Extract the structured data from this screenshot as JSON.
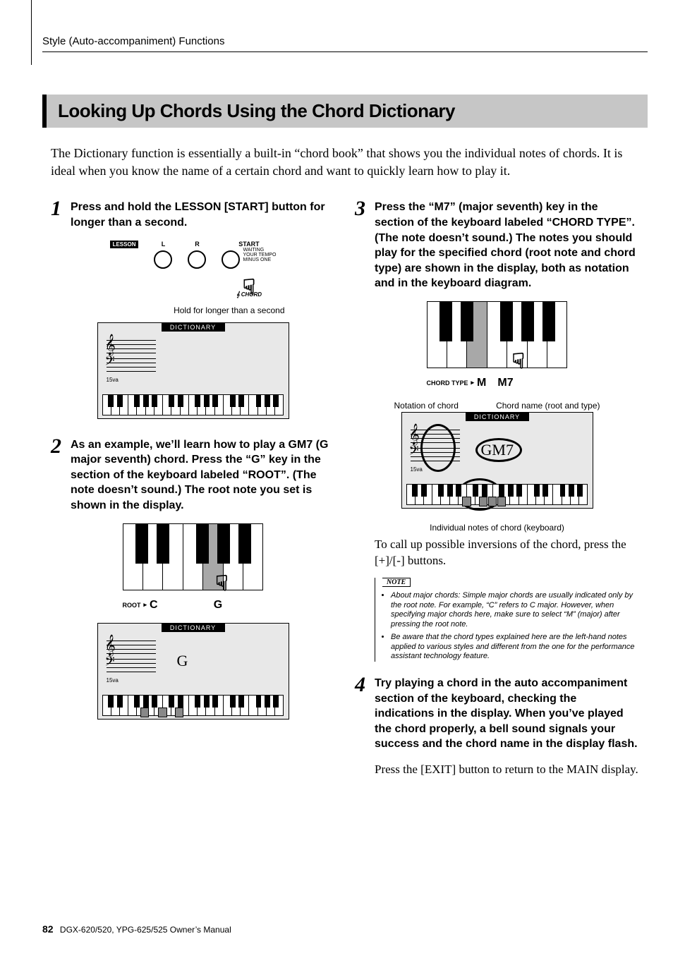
{
  "header": "Style (Auto-accompaniment) Functions",
  "section_title": "Looking Up Chords Using the Chord Dictionary",
  "intro": "The Dictionary function is essentially a built-in “chord book” that shows you the individual notes of chords. It is ideal when you know the name of a certain chord and want to quickly learn how to play it.",
  "step1": {
    "num": "1",
    "text": "Press and hold the LESSON [START] button for longer than a second.",
    "lesson_label": "LESSON",
    "btn_l": "L",
    "btn_r": "R",
    "btn_start": "START",
    "waiting_lines": "WAITING\nYOUR TEMPO\nMINUS ONE",
    "chord_small": "CHORD",
    "hold_caption": "Hold for longer than a second",
    "dict_title": "DICTIONARY"
  },
  "step2": {
    "num": "2",
    "text": "As an example, we’ll learn how to play a GM7 (G major seventh) chord. Press the “G” key in the section of the keyboard labeled “ROOT”. (The note doesn’t sound.) The root note you set is shown in the display.",
    "root_label": "ROOT",
    "root_arrow": "▸",
    "c_label": "C",
    "g_label": "G",
    "dict_title": "DICTIONARY",
    "chord_label": "G"
  },
  "step3": {
    "num": "3",
    "text": "Press the “M7” (major seventh) key in the section of the keyboard labeled “CHORD TYPE”. (The note doesn’t sound.) The notes you should play for the specified chord (root note and chord type) are shown in the display, both as notation and in the keyboard diagram.",
    "chordtype_label": "CHORD TYPE",
    "chordtype_arrow": "▸",
    "m_label": "M",
    "m7_label": "M7",
    "left_callout": "Notation of chord",
    "right_callout": "Chord name (root and type)",
    "dict_title": "DICTIONARY",
    "chord_label": "GM7",
    "bottom_callout": "Individual notes of chord (keyboard)",
    "body_after": "To call up possible inversions of the chord, press the [+]/[-] buttons."
  },
  "note": {
    "title": "NOTE",
    "items": [
      "About major chords: Simple major chords are usually indicated only by the root note. For example, “C” refers to C major. However, when specifying major chords here, make sure to select “M” (major) after pressing the root note.",
      "Be aware that the chord types explained here are the left-hand notes applied to various styles and different from the one for the performance assistant technology feature."
    ]
  },
  "step4": {
    "num": "4",
    "text": "Try playing a chord in the auto accompaniment section of the keyboard, checking the indications in the display. When you’ve played the chord properly, a bell sound signals your success and the chord name in the display flash.",
    "body_after": "Press the [EXIT] button to return to the MAIN display."
  },
  "footer": {
    "page": "82",
    "manual": "DGX-620/520, YPG-625/525 Owner’s Manual"
  }
}
